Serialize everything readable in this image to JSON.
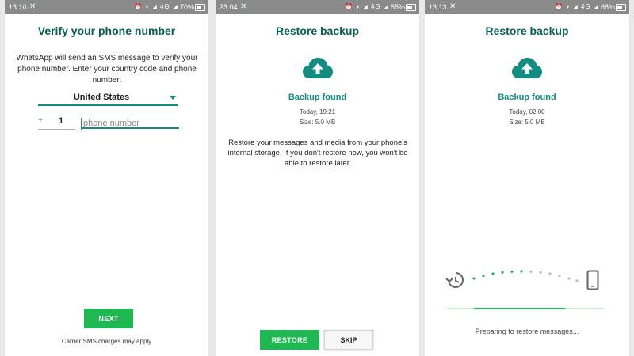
{
  "screens": [
    {
      "status": {
        "time": "13:10",
        "notif": "✕",
        "icons": "⏰ ▾ ◢ 4G ◢",
        "battery": "70%"
      },
      "title": "Verify your phone number",
      "description": "WhatsApp will send an SMS message to verify your phone number. Enter your country code and phone number:",
      "country": "United States",
      "cc_prefix": "+",
      "country_code": "1",
      "phone_placeholder": "phone number",
      "next_label": "NEXT",
      "footnote": "Carrier SMS charges may apply"
    },
    {
      "status": {
        "time": "23:04",
        "notif": "✕",
        "icons": "⏰ ▾ ◢ 4G ◢",
        "battery": "55%"
      },
      "title": "Restore backup",
      "found_label": "Backup found",
      "date": "Today, 19:21",
      "size": "Size: 5.0 MB",
      "description": "Restore your messages and media from your phone's internal storage. If you don't restore now, you won't be able to restore later.",
      "restore_label": "RESTORE",
      "skip_label": "SKIP"
    },
    {
      "status": {
        "time": "13:13",
        "notif": "✕",
        "icons": "⏰ ▾ ◢ 4G ◢",
        "battery": "68%"
      },
      "title": "Restore backup",
      "found_label": "Backup found",
      "date": "Today, 02:00",
      "size": "Size: 5.0 MB",
      "progress": 0.58,
      "progress_text": "Preparing to restore messages..."
    }
  ],
  "icons": {
    "cloud": "cloud-upload-icon",
    "history": "history-icon",
    "phone": "smartphone-icon",
    "dropdown": "caret-down-icon"
  },
  "colors": {
    "teal_dark": "#075e54",
    "teal": "#128c7e",
    "green": "#1fb853",
    "statusbar": "#8a8a8a"
  }
}
